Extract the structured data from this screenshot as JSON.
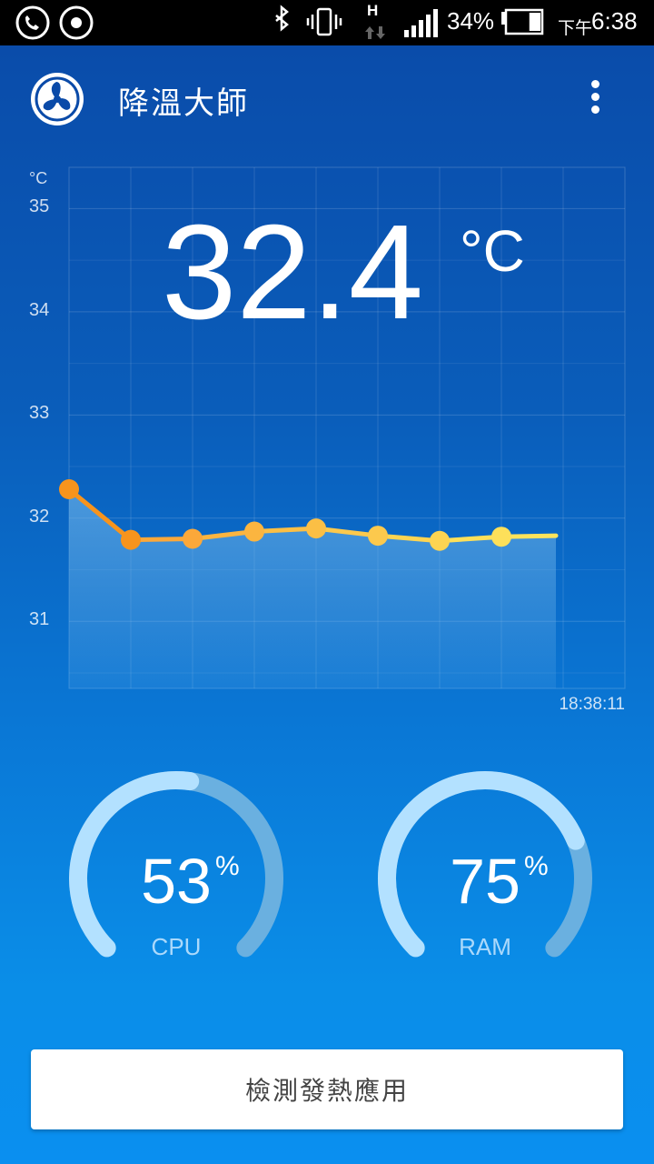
{
  "status_bar": {
    "battery_percent_text": "34%",
    "time_prefix": "下午",
    "time": "6:38",
    "network_type": "H",
    "battery_level": 0.34
  },
  "app_bar": {
    "title": "降溫大師",
    "logo_icon": "fan-icon",
    "menu_icon": "more-vertical-icon"
  },
  "temperature": {
    "value": "32.4",
    "unit": "°C"
  },
  "chart_data": {
    "type": "line",
    "ylabel": "°C",
    "y_ticks": [
      "35",
      "34",
      "33",
      "32",
      "31"
    ],
    "ylim": [
      30.35,
      35.4
    ],
    "x_end_label": "18:38:11",
    "series": [
      {
        "values": [
          32.28,
          31.79,
          31.8,
          31.87,
          31.9,
          31.83,
          31.78,
          31.82,
          31.83
        ]
      }
    ],
    "grid": true
  },
  "gauges": {
    "cpu": {
      "value": "53",
      "percent_sign": "%",
      "label": "CPU",
      "fraction": 0.53
    },
    "ram": {
      "value": "75",
      "percent_sign": "%",
      "label": "RAM",
      "fraction": 0.75
    }
  },
  "actions": {
    "detect_label": "檢測發熱應用"
  },
  "colors": {
    "accent_orange": "#f7941d",
    "accent_yellow": "#fde35b",
    "gauge_light": "#b3e1ff",
    "gauge_track": "#6ab0e0",
    "background_top": "#0a4aa8",
    "background_bottom": "#0a8ff0"
  }
}
